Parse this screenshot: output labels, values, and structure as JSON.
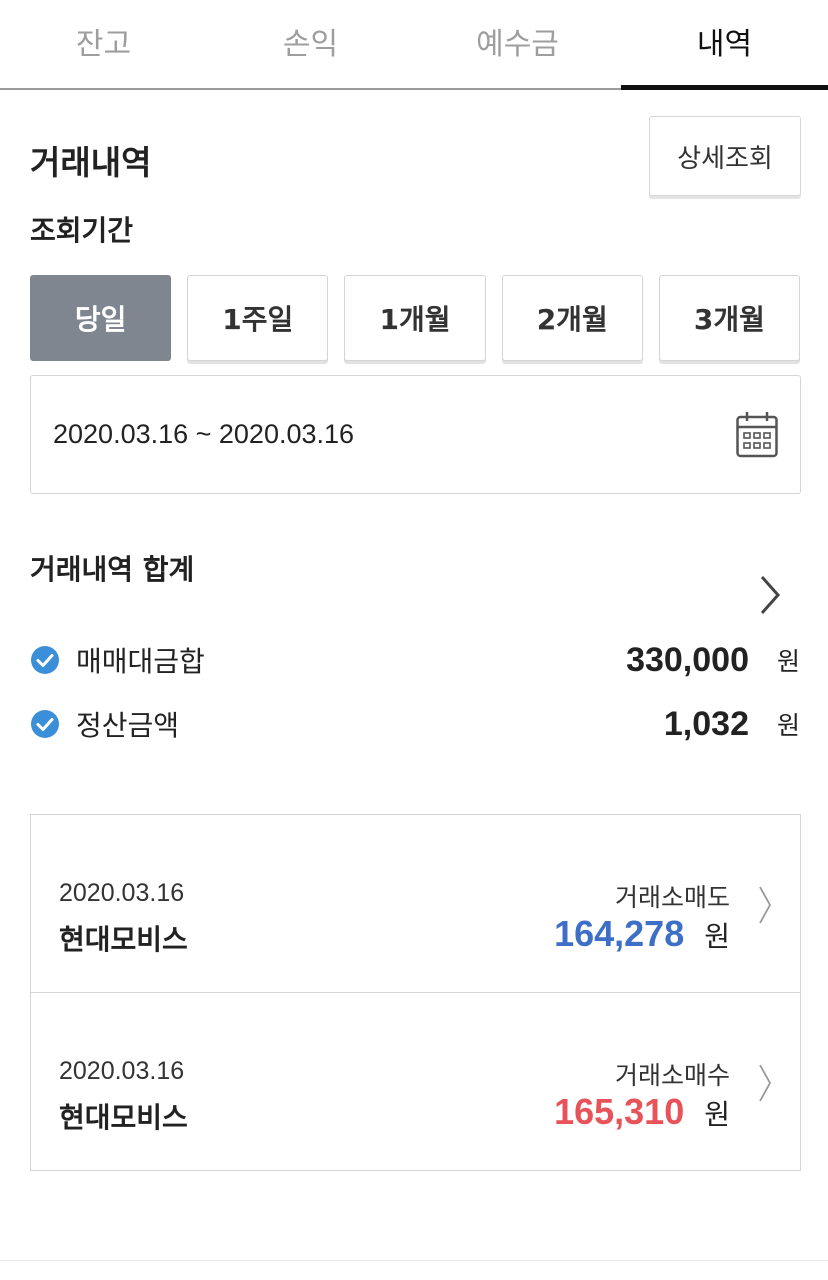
{
  "tabs": [
    {
      "label": "잔고"
    },
    {
      "label": "손익"
    },
    {
      "label": "예수금"
    },
    {
      "label": "내역",
      "active": true
    }
  ],
  "header": {
    "title": "거래내역",
    "detail_button": "상세조회"
  },
  "period": {
    "label": "조회기간",
    "options": [
      "당일",
      "1주일",
      "1개월",
      "2개월",
      "3개월"
    ],
    "selected": "당일",
    "date_range": "2020.03.16 ~ 2020.03.16"
  },
  "summary": {
    "title": "거래내역 합계",
    "rows": [
      {
        "label": "매매대금합",
        "value": "330,000",
        "unit": "원"
      },
      {
        "label": "정산금액",
        "value": "1,032",
        "unit": "원"
      }
    ]
  },
  "transactions": [
    {
      "date": "2020.03.16",
      "name": "현대모비스",
      "type": "거래소매도",
      "amount": "164,278",
      "unit": "원",
      "color": "#3d6fc6"
    },
    {
      "date": "2020.03.16",
      "name": "현대모비스",
      "type": "거래소매수",
      "amount": "165,310",
      "unit": "원",
      "color": "#e8525a"
    }
  ],
  "colors": {
    "active_period_bg": "#7f8690",
    "check_blue": "#3b8fd9"
  },
  "icons": {
    "calendar": "calendar-icon",
    "check": "check-circle-icon",
    "chevron": "chevron-right-icon"
  }
}
